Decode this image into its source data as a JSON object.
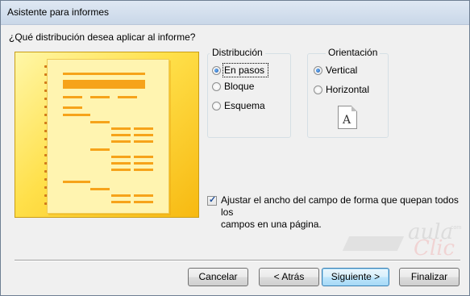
{
  "window": {
    "title": "Asistente para informes"
  },
  "question": "¿Qué distribución desea aplicar al informe?",
  "distribution": {
    "label": "Distribución",
    "options": [
      {
        "label": "En pasos",
        "selected": true
      },
      {
        "label": "Bloque",
        "selected": false
      },
      {
        "label": "Esquema",
        "selected": false
      }
    ]
  },
  "orientation": {
    "label": "Orientación",
    "options": [
      {
        "label": "Vertical",
        "selected": true
      },
      {
        "label": "Horizontal",
        "selected": false
      }
    ],
    "icon_glyph": "A"
  },
  "adjust_checkbox": {
    "checked": true,
    "line1": "Ajustar el ancho del campo de forma que quepan todos los",
    "line2": "campos en una página."
  },
  "buttons": {
    "cancel": "Cancelar",
    "back": "< Atrás",
    "next": "Siguiente >",
    "finish": "Finalizar"
  },
  "watermark": {
    "word1": "aula",
    "word2": "Clic",
    "suffix": ".com"
  },
  "colors": {
    "preview_start": "#fff7a8",
    "preview_end": "#f7b911",
    "bar": "#f6a31a",
    "default_button": "#bee6fd"
  }
}
